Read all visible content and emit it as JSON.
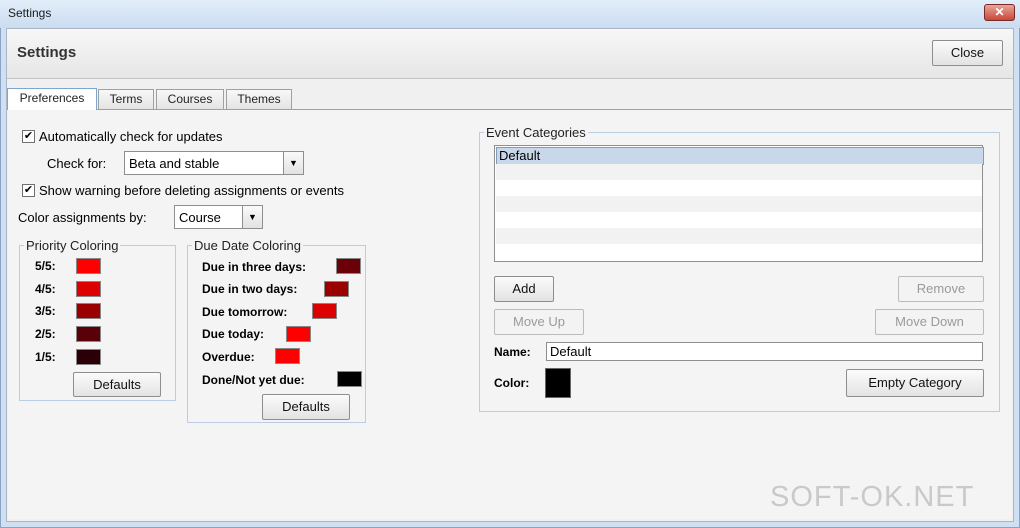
{
  "window": {
    "title": "Settings"
  },
  "header": {
    "title": "Settings",
    "close_label": "Close"
  },
  "tabs": [
    "Preferences",
    "Terms",
    "Courses",
    "Themes"
  ],
  "preferences": {
    "auto_update": {
      "label": "Automatically check for updates",
      "checked": true
    },
    "check_for": {
      "label": "Check for:",
      "value": "Beta and stable"
    },
    "warn_delete": {
      "label": "Show warning before deleting assignments or events",
      "checked": true
    },
    "color_by": {
      "label": "Color assignments by:",
      "value": "Course"
    }
  },
  "priority_coloring": {
    "title": "Priority Coloring",
    "items": [
      {
        "label": "5/5:",
        "color": "#ff0000"
      },
      {
        "label": "4/5:",
        "color": "#dd0000"
      },
      {
        "label": "3/5:",
        "color": "#9a0000"
      },
      {
        "label": "2/5:",
        "color": "#5a0008"
      },
      {
        "label": "1/5:",
        "color": "#2a0006"
      }
    ],
    "defaults_label": "Defaults"
  },
  "due_date_coloring": {
    "title": "Due Date Coloring",
    "items": [
      {
        "label": "Due in three days:",
        "color": "#6a0008"
      },
      {
        "label": "Due in two days:",
        "color": "#9a0000"
      },
      {
        "label": "Due tomorrow:",
        "color": "#dd0000"
      },
      {
        "label": "Due today:",
        "color": "#ff0000"
      },
      {
        "label": "Overdue:",
        "color": "#ff0000"
      },
      {
        "label": "Done/Not yet due:",
        "color": "#000000"
      }
    ],
    "defaults_label": "Defaults"
  },
  "event_categories": {
    "title": "Event Categories",
    "items": [
      "Default"
    ],
    "add_label": "Add",
    "remove_label": "Remove",
    "move_up_label": "Move Up",
    "move_down_label": "Move Down",
    "name_label": "Name:",
    "name_value": "Default",
    "color_label": "Color:",
    "color_value": "#000000",
    "empty_label": "Empty Category"
  },
  "watermark": "SOFT-OK.NET"
}
